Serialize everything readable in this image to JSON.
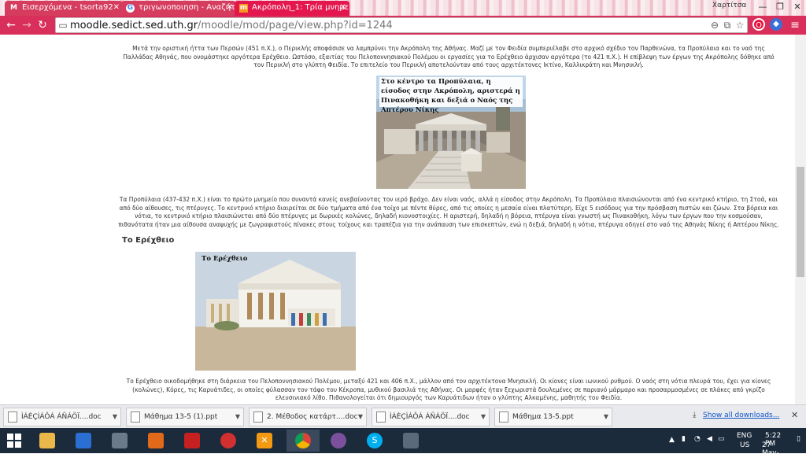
{
  "browser": {
    "tabs": [
      {
        "label": "Εισερχόμενα - tsorta92",
        "favicon": "M"
      },
      {
        "label": "τριγωνοποιηση - Αναζήτ",
        "favicon": "G"
      },
      {
        "label": "Ακρόπολη_1: Τρία μνημε",
        "favicon": "m"
      }
    ],
    "profile_name": "Χαρτίτσα",
    "url_host": "moodle.sedict.sed.uth.gr",
    "url_path": "/moodle/mod/page/view.php?id=1244",
    "accent": "#d8305a"
  },
  "page": {
    "intro": "Μετά την οριστική ήττα των Περσών (451 π.Χ.), ο Περικλής αποφάσισε να λαμπρύνει την Ακρόπολη της Αθήνας. Μαζί με τον Φειδία συμπεριέλαβε στο αρχικό σχέδιο τον Παρθενώνα, τα Προπύλαια και το ναό της Παλλάδας Αθηνάς, που ονομάστηκε αργότερα Ερέχθειο. Ωστόσο, εξαιτίας του Πελοποννησιακού Πολέμου οι εργασίες για το Ερέχθειο άρχισαν αργότερα (το 421 π.Χ.). Η επίβλεψη των έργων της Ακρόπολης δόθηκε από τον Περικλή στο γλύπτη Φειδία. Το επιτελείο του Περικλή αποτελούνταν από τους αρχιτέκτονες Ικτίνο, Καλλικράτη και Μνησικλή.",
    "image1_caption": "Στο κέντρο τα Προπύλαια, η είσοδος στην Ακρόπολη, αριστερά η Πινακοθήκη και δεξιά ο Ναός της Απτέρου Νίκης",
    "propylaia_text": "Τα Προπύλαια (437-432 π.Χ.) είναι το πρώτο μνημείο που συναντά κανείς ανεβαίνοντας τον ιερό βράχο. Δεν είναι ναός, αλλά η είσοδος στην Ακρόπολη. Τα Προπύλαια πλαισιώνονται από ένα κεντρικό κτήριο, τη Στοά, και από δύο αίθουσες, τις πτέρυγες. Το κεντρικό κτήριο διαιρείται σε δύο τμήματα από ένα τοίχο με πέντε θύρες, από τις οποίες η μεσαία είναι πλατύτερη. Είχε 5 εισόδους για την πρόσβαση πιστών και ζώων. Στα βόρεια και νότια, το κεντρικό κτήριο πλαισιώνεται από δύο πτέρυγες με δωρικές κολώνες, δηλαδή κιονοστοιχίες. Η αριστερή, δηλαδή η βόρεια, πτέρυγα είναι γνωστή ως Πινακοθήκη, λόγω των έργων που την κοσμούσαν, πιθανότατα ήταν μια αίθουσα αναψυχής με ζωγραφιστούς πίνακες στους τοίχους και τραπέζια για την ανάπαυση των επισκεπτών, ενώ η δεξιά, δηλαδή η νότια, πτέρυγα οδηγεί στο ναό της Αθηνάς Νίκης ή Απτέρου Νίκης.",
    "heading_erechtheio": "Το Ερέχθειο",
    "image2_caption": "Το Ερέχθειο",
    "erechtheio_text": "Το Ερέχθειο οικοδομήθηκε στη διάρκεια του Πελοποννησιακού Πολέμου, μεταξύ 421 και 406 π.Χ., μάλλον από τον αρχιτέκτονα Μνησικλή. Οι κίονες είναι ιωνικού ρυθμού. Ο ναός στη νότια πλευρά του, έχει για κίονες (κολώνες), Κόρες, τις Καρυάτιδες, οι οποίες φύλασσαν τον τάφο του Κέκροπα, μυθικού βασιλιά της Αθήνας. Οι μορφές ήταν ξεχωριστά δουλεμένες σε παριανό μάρμαρο και προσαρμοσμένες σε πλάκες από γκρίζο ελευσινιακό λίθο. Πιθανολογείται ότι δημιουργός των Καρυάτιδων ήταν ο γλύπτης Αλκαμένης, μαθητής του Φειδία."
  },
  "downloads": {
    "items": [
      {
        "label": "ÌÁÈÇÌÁÔÁ ÁÑÁÖÏ....doc",
        "type": "doc"
      },
      {
        "label": "Μάθημα 13-5 (1).ppt",
        "type": "ppt"
      },
      {
        "label": "2. Μέθοδος κατάρτ....doc",
        "type": "doc"
      },
      {
        "label": "ÌÁÈÇÌÁÔÁ ÁÑÁÖÏ....doc",
        "type": "doc"
      },
      {
        "label": "Μάθημα 13-5.ppt",
        "type": "ppt"
      }
    ],
    "show_all": "Show all downloads..."
  },
  "taskbar": {
    "apps": [
      {
        "name": "start",
        "color": "#1b2b3c"
      },
      {
        "name": "file-explorer",
        "color": "#e8b84a"
      },
      {
        "name": "app-blue",
        "color": "#2a6fd1"
      },
      {
        "name": "app-calc",
        "color": "#6a7a8a"
      },
      {
        "name": "app-orange",
        "color": "#e06a1a"
      },
      {
        "name": "app-pdf",
        "color": "#c62020"
      },
      {
        "name": "app-red",
        "color": "#d03030"
      },
      {
        "name": "app-x",
        "color": "#f39a12"
      },
      {
        "name": "chrome",
        "color": "#3a8d3a"
      },
      {
        "name": "viber",
        "color": "#7b519d"
      },
      {
        "name": "skype",
        "color": "#00aff0"
      },
      {
        "name": "app-doc",
        "color": "#5a6a7a"
      }
    ],
    "lang": "ENG",
    "region": "US",
    "time": "5:22 PM",
    "date": "27-May-16"
  }
}
